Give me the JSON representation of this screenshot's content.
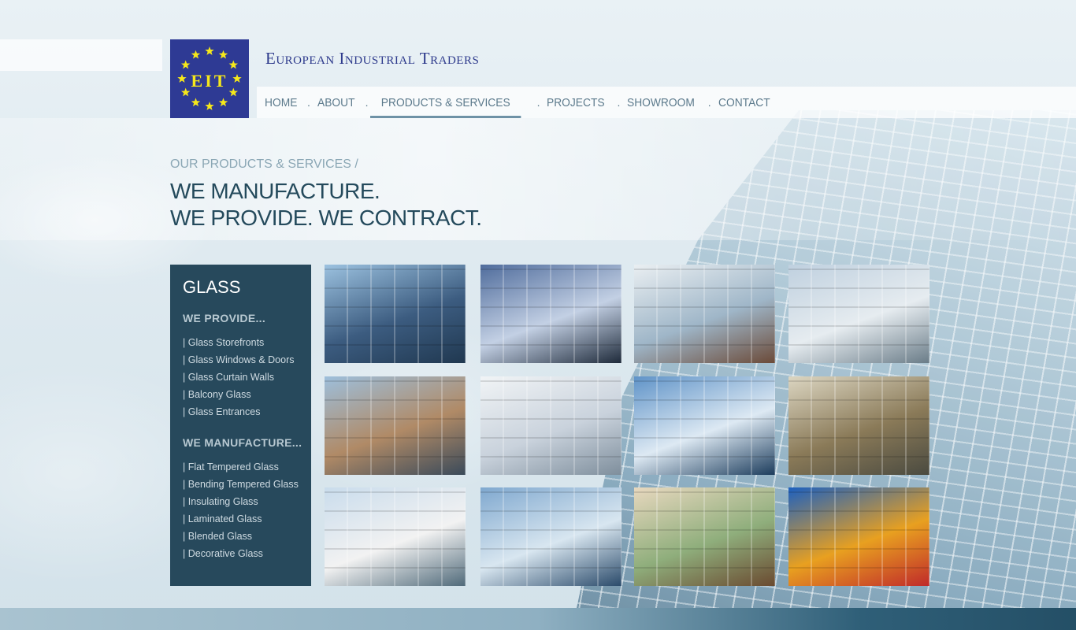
{
  "brand": {
    "title": "European Industrial Traders",
    "logo_text": "EIT"
  },
  "nav": [
    {
      "label": "HOME"
    },
    {
      "label": "ABOUT"
    },
    {
      "label": "PRODUCTS & SERVICES",
      "active": true
    },
    {
      "label": "PROJECTS"
    },
    {
      "label": "SHOWROOM"
    },
    {
      "label": "CONTACT"
    }
  ],
  "page": {
    "breadcrumb": "OUR PRODUCTS & SERVICES /",
    "headline_line1": "WE MANUFACTURE.",
    "headline_line2": "WE PROVIDE. WE CONTRACT."
  },
  "sidebar": {
    "title": "GLASS",
    "provide_heading": "WE PROVIDE...",
    "provide_items": [
      "Glass Storefronts",
      "Glass Windows & Doors",
      "Glass Curtain Walls",
      "Balcony Glass",
      "Glass Entrances"
    ],
    "manufacture_heading": "WE MANUFACTURE...",
    "manufacture_items": [
      "Flat Tempered Glass",
      "Bending Tempered Glass",
      "Insulating Glass",
      "Laminated Glass",
      "Blended Glass",
      "Decorative Glass"
    ]
  },
  "gallery": [
    {
      "name": "glass-building-photo",
      "colors": [
        "#9cc2e0",
        "#3c5c80",
        "#203850"
      ]
    },
    {
      "name": "balcony-sunset-photo",
      "colors": [
        "#4f6c9c",
        "#c3d0e4",
        "#1e2a3a"
      ]
    },
    {
      "name": "apartment-interior-photo",
      "colors": [
        "#eaeff2",
        "#9fb6c8",
        "#6b4a38"
      ]
    },
    {
      "name": "white-house-sunroom-photo",
      "colors": [
        "#bfd0df",
        "#e6ecf0",
        "#6a7c88"
      ]
    },
    {
      "name": "modern-balcony-house-photo",
      "colors": [
        "#9dbfdc",
        "#b08a66",
        "#3a4a5a"
      ]
    },
    {
      "name": "white-lobby-photo",
      "colors": [
        "#f1f4f6",
        "#c9d2dc",
        "#7e8e9c"
      ]
    },
    {
      "name": "sky-reflection-facade-photo",
      "colors": [
        "#5f93c8",
        "#dde9f3",
        "#1c3c5c"
      ]
    },
    {
      "name": "decorative-glass-doors-photo",
      "colors": [
        "#dcd6c2",
        "#8a7a58",
        "#4a4a40"
      ]
    },
    {
      "name": "curved-glass-building-photo",
      "colors": [
        "#c9dcec",
        "#f2f2f2",
        "#506a7a"
      ]
    },
    {
      "name": "curtain-wall-photo",
      "colors": [
        "#7fa8cf",
        "#d8e6f0",
        "#2a4a6a"
      ]
    },
    {
      "name": "living-room-view-photo",
      "colors": [
        "#e8d8bf",
        "#8fae7c",
        "#6a4a30"
      ]
    },
    {
      "name": "stained-glass-photo",
      "colors": [
        "#1c60c0",
        "#e8a020",
        "#c02a2a"
      ]
    }
  ]
}
